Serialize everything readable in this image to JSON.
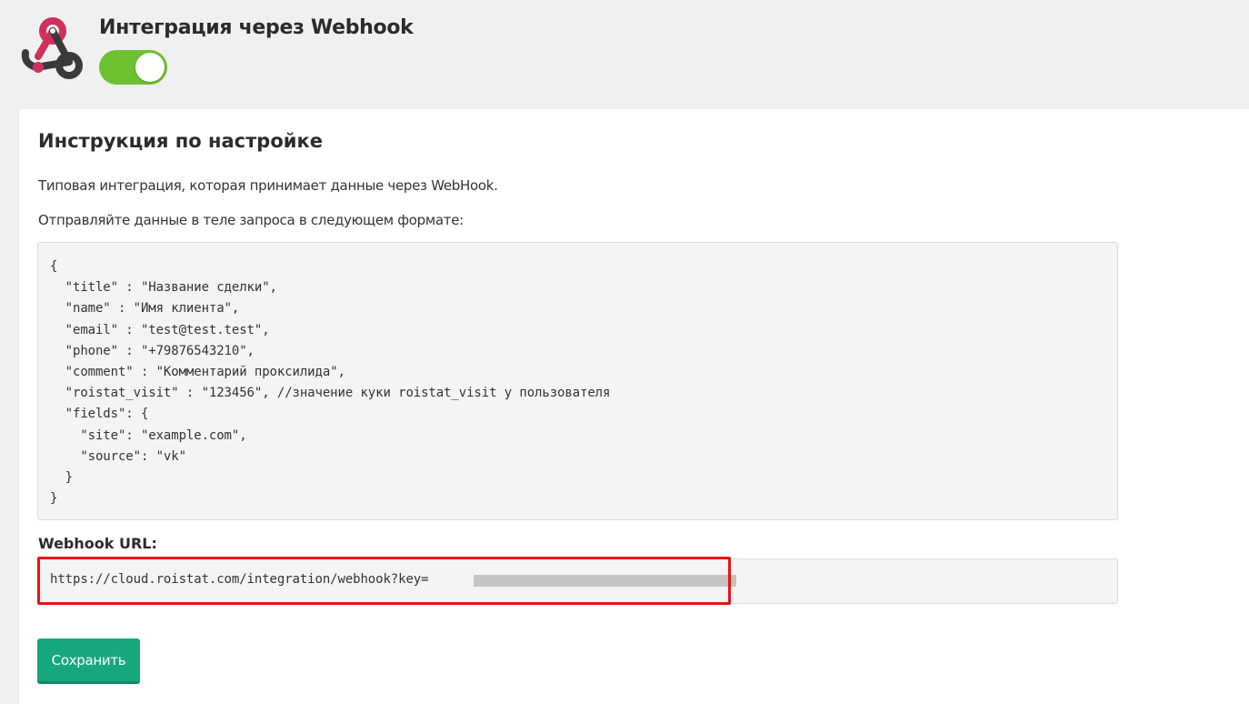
{
  "header": {
    "title": "Интеграция через Webhook",
    "logo_icon": "webhook-logo-icon",
    "toggle_state": "on",
    "toggle_color": "#6dc12e"
  },
  "main": {
    "section_title": "Инструкция по настройке",
    "description_1": "Типовая интеграция, которая принимает данные через WebHook.",
    "description_2": "Отправляйте данные в теле запроса в следующем формате:",
    "code_lines": [
      "{",
      "  \"title\" : \"Название сделки\",",
      "  \"name\" : \"Имя клиента\",",
      "  \"email\" : \"test@test.test\",",
      "  \"phone\" : \"+79876543210\",",
      "  \"comment\" : \"Комментарий проксилида\",",
      "  \"roistat_visit\" : \"123456\", //значение куки roistat_visit у пользователя",
      "  \"fields\": {",
      "    \"site\": \"example.com\",",
      "    \"source\": \"vk\"",
      "  }",
      "}"
    ],
    "url_label": "Webhook URL:",
    "url_value": "https://cloud.roistat.com/integration/webhook?key=",
    "save_label": "Сохранить"
  },
  "colors": {
    "accent_button": "#16a77e",
    "highlight_border": "#ee1111",
    "logo_red": "#d0305c",
    "logo_dark": "#3a3a3a"
  }
}
